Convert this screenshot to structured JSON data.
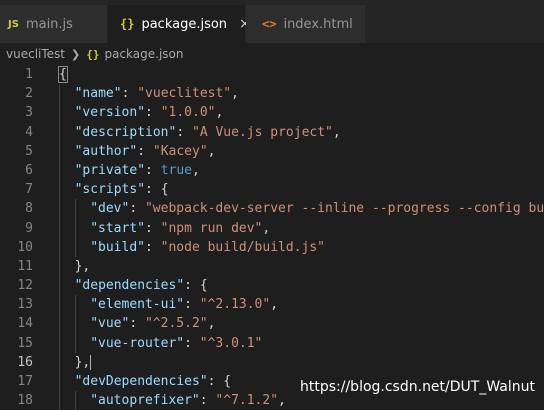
{
  "tabs": [
    {
      "icon": "JS",
      "label": "main.js",
      "active": false
    },
    {
      "icon": "{}",
      "label": "package.json",
      "active": true,
      "close": "×"
    },
    {
      "icon": "<>",
      "label": "index.html",
      "active": false
    }
  ],
  "breadcrumb": {
    "folder": "vuecliTest",
    "icon": "{}",
    "file": "package.json"
  },
  "lines": [
    {
      "n": "1",
      "tokens": [
        [
          "p",
          "{"
        ]
      ]
    },
    {
      "n": "2",
      "tokens": [
        [
          "k",
          "\"name\""
        ],
        [
          "p",
          ": "
        ],
        [
          "s",
          "\"vueclitest\""
        ],
        [
          "p",
          ","
        ]
      ]
    },
    {
      "n": "3",
      "tokens": [
        [
          "k",
          "\"version\""
        ],
        [
          "p",
          ": "
        ],
        [
          "s",
          "\"1.0.0\""
        ],
        [
          "p",
          ","
        ]
      ]
    },
    {
      "n": "4",
      "tokens": [
        [
          "k",
          "\"description\""
        ],
        [
          "p",
          ": "
        ],
        [
          "s",
          "\"A Vue.js project\""
        ],
        [
          "p",
          ","
        ]
      ]
    },
    {
      "n": "5",
      "tokens": [
        [
          "k",
          "\"author\""
        ],
        [
          "p",
          ": "
        ],
        [
          "s",
          "\"Kacey\""
        ],
        [
          "p",
          ","
        ]
      ]
    },
    {
      "n": "6",
      "tokens": [
        [
          "k",
          "\"private\""
        ],
        [
          "p",
          ": "
        ],
        [
          "b",
          "true"
        ],
        [
          "p",
          ","
        ]
      ]
    },
    {
      "n": "7",
      "tokens": [
        [
          "k",
          "\"scripts\""
        ],
        [
          "p",
          ": {"
        ]
      ]
    },
    {
      "n": "8",
      "tokens": [
        [
          "k",
          "\"dev\""
        ],
        [
          "p",
          ": "
        ],
        [
          "s",
          "\"webpack-dev-server --inline --progress --config bui"
        ]
      ]
    },
    {
      "n": "9",
      "tokens": [
        [
          "k",
          "\"start\""
        ],
        [
          "p",
          ": "
        ],
        [
          "s",
          "\"npm run dev\""
        ],
        [
          "p",
          ","
        ]
      ]
    },
    {
      "n": "10",
      "tokens": [
        [
          "k",
          "\"build\""
        ],
        [
          "p",
          ": "
        ],
        [
          "s",
          "\"node build/build.js\""
        ]
      ]
    },
    {
      "n": "11",
      "tokens": [
        [
          "p",
          "},"
        ]
      ]
    },
    {
      "n": "12",
      "tokens": [
        [
          "k",
          "\"dependencies\""
        ],
        [
          "p",
          ": {"
        ]
      ]
    },
    {
      "n": "13",
      "tokens": [
        [
          "k",
          "\"element-ui\""
        ],
        [
          "p",
          ": "
        ],
        [
          "s",
          "\"^2.13.0\""
        ],
        [
          "p",
          ","
        ]
      ]
    },
    {
      "n": "14",
      "tokens": [
        [
          "k",
          "\"vue\""
        ],
        [
          "p",
          ": "
        ],
        [
          "s",
          "\"^2.5.2\""
        ],
        [
          "p",
          ","
        ]
      ]
    },
    {
      "n": "15",
      "tokens": [
        [
          "k",
          "\"vue-router\""
        ],
        [
          "p",
          ": "
        ],
        [
          "s",
          "\"^3.0.1\""
        ]
      ]
    },
    {
      "n": "16",
      "tokens": [
        [
          "p",
          "},"
        ]
      ]
    },
    {
      "n": "17",
      "tokens": [
        [
          "k",
          "\"devDependencies\""
        ],
        [
          "p",
          ": {"
        ]
      ]
    },
    {
      "n": "18",
      "tokens": [
        [
          "k",
          "\"autoprefixer\""
        ],
        [
          "p",
          ": "
        ],
        [
          "s",
          "\"^7.1.2\""
        ],
        [
          "p",
          ","
        ]
      ]
    }
  ],
  "watermark": "https://blog.csdn.net/DUT_Walnut",
  "colors": {
    "editor_bg": "#1e1e1e",
    "key": "#9cdcfe",
    "string": "#ce9178",
    "boolean": "#569cd6",
    "json_icon": "#cbcb41",
    "html_icon": "#e37933"
  }
}
